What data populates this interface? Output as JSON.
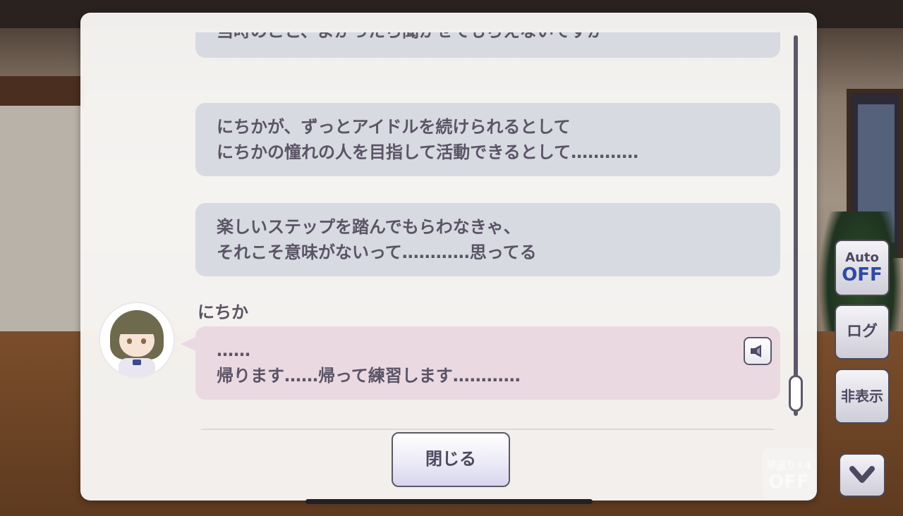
{
  "messages": [
    {
      "lines": [
        "当時のこと、よかったら聞かせてもらえないですか"
      ]
    },
    {
      "lines": [
        "にちかが、ずっとアイドルを続けられるとして",
        "にちかの憧れの人を目指して活動できるとして…………"
      ]
    },
    {
      "lines": [
        "楽しいステップを踏んでもらわなきゃ、",
        "それこそ意味がないって…………思ってる"
      ]
    },
    {
      "speaker": "にちか",
      "lines": [
        "……",
        "帰ります……帰って練習します…………"
      ]
    }
  ],
  "close_button": "閉じる",
  "controls": {
    "auto_label": "Auto",
    "auto_state": "OFF",
    "log_label": "ログ",
    "hide_label": "非表示",
    "speed_label": "早送り×4",
    "speed_state": "OFF"
  },
  "colors": {
    "bubble_other": "#d7dae1",
    "bubble_speaker": "#ebd9e2",
    "text": "#5b5466",
    "auto_state": "#2f4aa6"
  },
  "icons": [
    "speaker-icon",
    "chevron-down-icon"
  ]
}
